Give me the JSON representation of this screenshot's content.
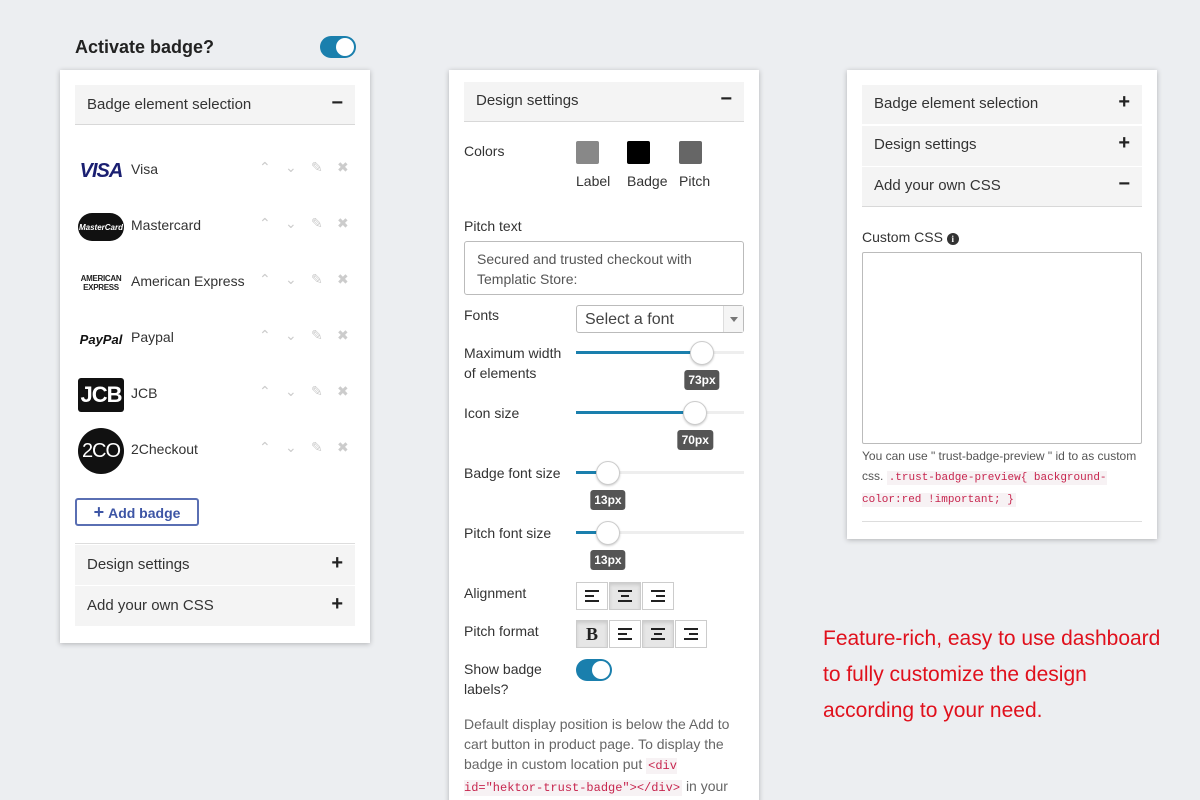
{
  "header": {
    "title": "Activate badge?",
    "activated": true,
    "accent": "#1a7fad"
  },
  "card1": {
    "section_open": {
      "label": "Badge element selection",
      "sign": "−"
    },
    "badges": [
      {
        "logo": "VISA",
        "name": "Visa"
      },
      {
        "logo": "MasterCard",
        "name": "Mastercard"
      },
      {
        "logo": "AMERICAN EXPRESS",
        "name": "American Express"
      },
      {
        "logo": "PayPal",
        "name": "Paypal"
      },
      {
        "logo": "JCB",
        "name": "JCB"
      },
      {
        "logo": "2CO",
        "name": "2Checkout"
      }
    ],
    "add_label": "Add badge",
    "sections_closed": [
      {
        "label": "Design settings",
        "sign": "+"
      },
      {
        "label": "Add your own CSS",
        "sign": "+"
      }
    ]
  },
  "card2": {
    "section": {
      "label": "Design settings",
      "sign": "−"
    },
    "colors_label": "Colors",
    "colors": [
      {
        "label": "Label",
        "color": "#888888"
      },
      {
        "label": "Badge",
        "color": "#000000"
      },
      {
        "label": "Pitch",
        "color": "#666666"
      }
    ],
    "pitch_text_label": "Pitch text",
    "pitch_text": "Secured and trusted checkout with Templatic Store:",
    "fonts_label": "Fonts",
    "font_placeholder": "Select a font",
    "sliders": [
      {
        "label": "Maximum width of elements",
        "value": "73px",
        "fraction": 0.75
      },
      {
        "label": "Icon size",
        "value": "70px",
        "fraction": 0.71
      },
      {
        "label": "Badge font size",
        "value": "13px",
        "fraction": 0.19
      },
      {
        "label": "Pitch font size",
        "value": "13px",
        "fraction": 0.19
      }
    ],
    "alignment_label": "Alignment",
    "pitch_format_label": "Pitch format",
    "bold_glyph": "B",
    "show_labels_label": "Show badge labels?",
    "show_labels": true,
    "note_before": "Default display position is below the Add to cart button in product page. To display the badge in custom location put",
    "note_code": "<div id=\"hektor-trust-badge\"></div>",
    "note_after": "in your desired location of the template file."
  },
  "card3": {
    "sections": [
      {
        "label": "Badge element selection",
        "sign": "+"
      },
      {
        "label": "Design settings",
        "sign": "+"
      },
      {
        "label": "Add your own CSS",
        "sign": "−"
      }
    ],
    "custom_css_label": "Custom CSS",
    "info_glyph": "i",
    "note_text": "You can use \" trust-badge-preview \" id to as custom css.",
    "note_code": ".trust-badge-preview{ background-color:red !important; }"
  },
  "promo": {
    "line1": "Feature-rich, easy to use dashboard",
    "line2": "to fully customize the design",
    "line3": "according to your need.",
    "color": "#e0101c"
  }
}
